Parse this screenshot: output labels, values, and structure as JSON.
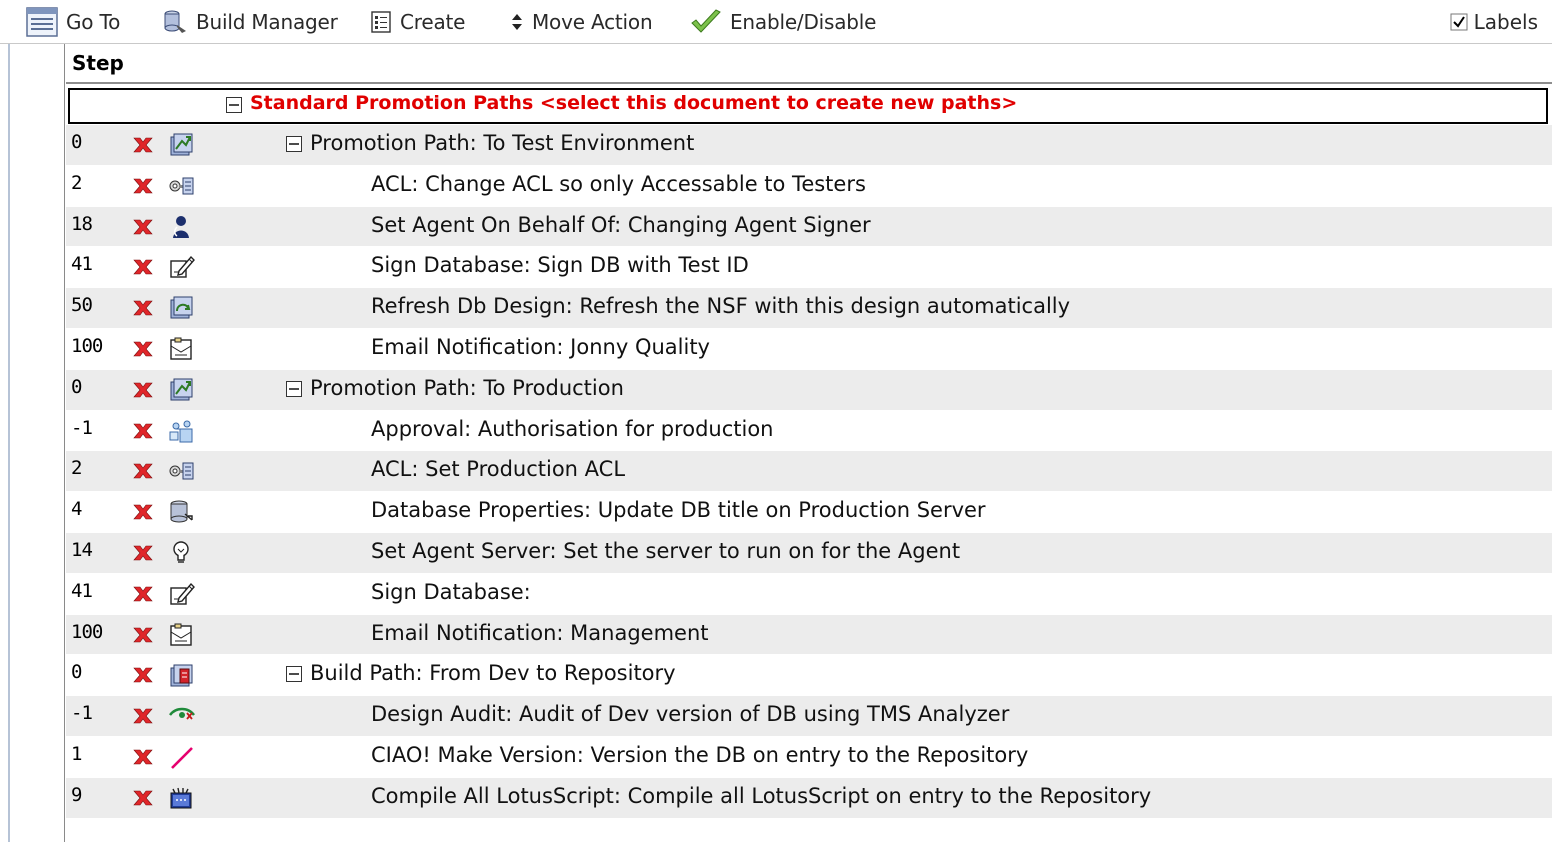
{
  "toolbar": {
    "goto": "Go To",
    "build_manager": "Build Manager",
    "create": "Create",
    "move_action": "Move Action",
    "enable_disable": "Enable/Disable",
    "labels": "Labels",
    "labels_checked": true
  },
  "header": {
    "step": "Step"
  },
  "category": {
    "label": "Standard Promotion Paths <select this document to create new paths>"
  },
  "colors": {
    "category_text": "#e00000",
    "row_shade": "#ececec",
    "delete_x": "#e0262a"
  },
  "rows": [
    {
      "step": "0",
      "kind": "path",
      "icon": "promotion-path-icon",
      "desc": "Promotion Path: To Test Environment"
    },
    {
      "step": "2",
      "kind": "action",
      "icon": "acl-key-icon",
      "desc": "ACL: Change ACL so only Accessable to Testers"
    },
    {
      "step": "18",
      "kind": "action",
      "icon": "agent-signer-icon",
      "desc": "Set Agent On Behalf Of: Changing Agent Signer"
    },
    {
      "step": "41",
      "kind": "action",
      "icon": "sign-database-icon",
      "desc": "Sign Database: Sign DB with Test ID"
    },
    {
      "step": "50",
      "kind": "action",
      "icon": "refresh-design-icon",
      "desc": "Refresh Db Design: Refresh the NSF with this design automatically"
    },
    {
      "step": "100",
      "kind": "action",
      "icon": "email-notification-icon",
      "desc": "Email Notification: Jonny Quality"
    },
    {
      "step": "0",
      "kind": "path",
      "icon": "promotion-path-icon",
      "desc": "Promotion Path: To Production"
    },
    {
      "step": "-1",
      "kind": "action",
      "icon": "approval-icon",
      "desc": "Approval: Authorisation for production"
    },
    {
      "step": "2",
      "kind": "action",
      "icon": "acl-key-icon",
      "desc": "ACL: Set Production ACL"
    },
    {
      "step": "4",
      "kind": "action",
      "icon": "database-properties-icon",
      "desc": "Database Properties: Update DB title on Production Server"
    },
    {
      "step": "14",
      "kind": "action",
      "icon": "agent-server-icon",
      "desc": "Set Agent Server: Set the server to run on for the Agent"
    },
    {
      "step": "41",
      "kind": "action",
      "icon": "sign-database-icon",
      "desc": "Sign Database:"
    },
    {
      "step": "100",
      "kind": "action",
      "icon": "email-notification-icon",
      "desc": "Email Notification: Management"
    },
    {
      "step": "0",
      "kind": "path",
      "icon": "build-path-icon",
      "desc": "Build Path: From Dev to Repository"
    },
    {
      "step": "-1",
      "kind": "action",
      "icon": "design-audit-icon",
      "desc": "Design Audit: Audit of Dev version of DB using TMS Analyzer"
    },
    {
      "step": "1",
      "kind": "action",
      "icon": "make-version-icon",
      "desc": "CIAO! Make Version: Version the DB on entry to the Repository"
    },
    {
      "step": "9",
      "kind": "action",
      "icon": "compile-lotusscript-icon",
      "desc": "Compile All LotusScript: Compile all LotusScript on entry to the Repository"
    }
  ]
}
